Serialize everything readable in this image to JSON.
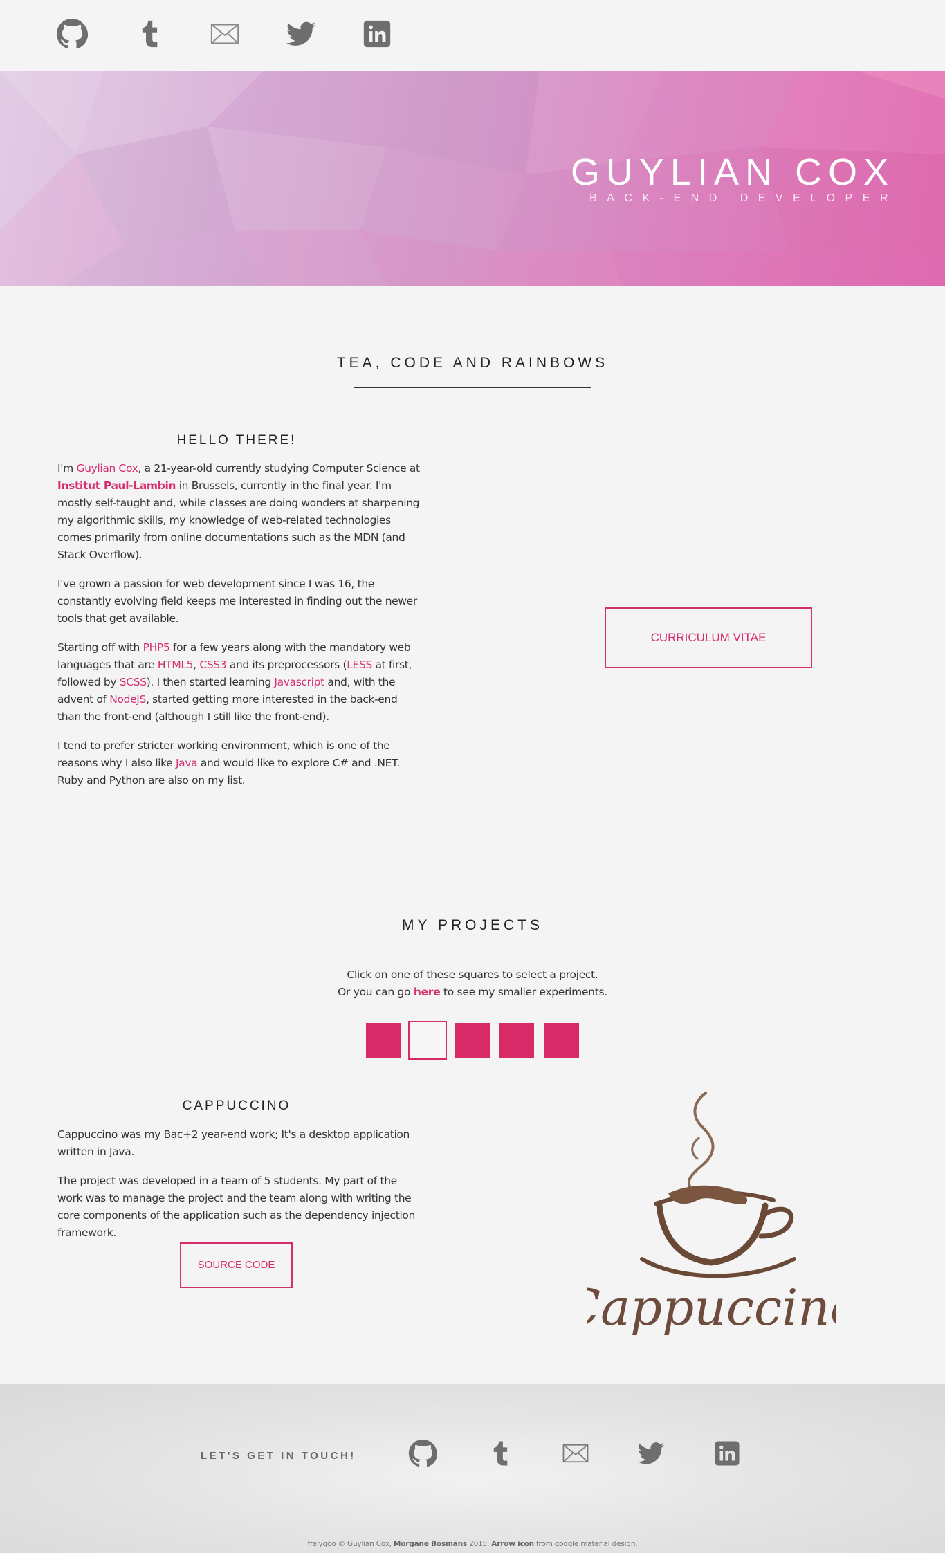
{
  "social": [
    {
      "name": "github-icon",
      "label": "GitHub"
    },
    {
      "name": "tumblr-icon",
      "label": "Tumblr"
    },
    {
      "name": "mail-icon",
      "label": "Mail"
    },
    {
      "name": "twitter-icon",
      "label": "Twitter"
    },
    {
      "name": "linkedin-icon",
      "label": "LinkedIn"
    }
  ],
  "hero": {
    "name": "GUYLIAN COX",
    "subtitle": "BACK-END DEVELOPER"
  },
  "about": {
    "title": "TEA, CODE AND RAINBOWS",
    "heading": "HELLO THERE!",
    "p1": {
      "a": "I'm ",
      "link_name": "Guylian Cox",
      "b": ", a 21-year-old currently studying Computer Science at ",
      "link_school": "Institut Paul-Lambin",
      "c": " in Brussels, currently in the final year. I'm mostly self-taught and, while classes are doing wonders at sharpening my algorithmic skills, my knowledge of web-related technologies comes primarily from online documentations such as the ",
      "mdn": "MDN",
      "d": " (and Stack Overflow)."
    },
    "p2": "I've grown a passion for web development since I was 16, the constantly evolving field keeps me interested in finding out the newer tools that get available.",
    "p3": {
      "a": "Starting off with ",
      "php": "PHP5",
      "b": " for a few years along with the mandatory web languages that are ",
      "html": "HTML5",
      "c": ", ",
      "css": "CSS3",
      "d": " and its preprocessors (",
      "less": "LESS",
      "e": " at first, followed by ",
      "scss": "SCSS",
      "f": "). I then started learning ",
      "js": "Javascript",
      "g": " and, with the advent of ",
      "node": "NodeJS",
      "h": ", started getting more interested in the back-end than the front-end (although I still like the front-end)."
    },
    "p4": {
      "a": "I tend to prefer stricter working environment, which is one of the reasons why I also like ",
      "java": "Java",
      "b": " and would like to explore C# and .NET. Ruby and Python are also on my list."
    },
    "cv_button": "CURRICULUM VITAE"
  },
  "projects": {
    "title": "MY PROJECTS",
    "line1": "Click on one of these squares to select a project.",
    "line2a": "Or you can go ",
    "line2_link": "here",
    "line2b": " to see my smaller experiments.",
    "selected_index": 1,
    "project": {
      "name": "CAPPUCCINO",
      "p1": "Cappuccino was my Bac+2 year-end work; It's a desktop application written in Java.",
      "p2": "The project was developed in a team of 5 students. My part of the work was to manage the project and the team along with writing the core components of the application such as the dependency injection framework.",
      "source_button": "SOURCE CODE",
      "logo_text": "Cappuccino"
    }
  },
  "footer": {
    "label": "LET'S GET IN TOUCH!",
    "credits_a": "ffelyqoo © Guylian Cox, ",
    "credits_b": "Morgane Bosmans",
    "credits_c": " 2015. ",
    "credits_d": "Arrow icon",
    "credits_e": " from google material design."
  },
  "colors": {
    "accent": "#d62d6f",
    "icon_gray": "#6e6e6e",
    "background": "#f4f4f4"
  }
}
